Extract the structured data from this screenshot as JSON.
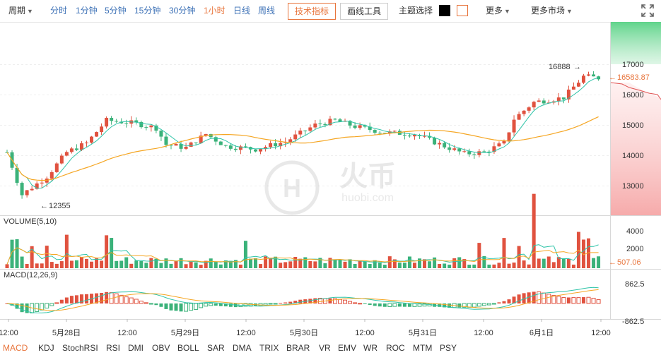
{
  "toolbar": {
    "period_label": "周期",
    "periods": [
      {
        "label": "分时",
        "active": false
      },
      {
        "label": "1分钟",
        "active": false
      },
      {
        "label": "5分钟",
        "active": false
      },
      {
        "label": "15分钟",
        "active": false
      },
      {
        "label": "30分钟",
        "active": false
      },
      {
        "label": "1小时",
        "active": true
      },
      {
        "label": "日线",
        "active": false
      },
      {
        "label": "周线",
        "active": false
      }
    ],
    "tech_indicator_label": "技术指标",
    "draw_tool_label": "画线工具",
    "theme_label": "主题选择",
    "more_label": "更多",
    "more_markets_label": "更多市场"
  },
  "colors": {
    "accent": "#e8743b",
    "up": "#e0523f",
    "down": "#3bb27a",
    "ma_short": "#2ec4a8",
    "ma_long": "#f5a623",
    "link": "#3a6fb5"
  },
  "chart": {
    "high_marker": "16888",
    "low_marker": "12355",
    "current_price": "16583.87",
    "price_ticks": [
      "17000",
      "16000",
      "15000",
      "14000",
      "13000"
    ],
    "volume_label": "VOLUME(5,10)",
    "volume_ticks": [
      "4000",
      "2000"
    ],
    "volume_current": "507.06",
    "macd_label": "MACD(12,26,9)",
    "macd_ticks": [
      "862.5",
      "-862.5"
    ],
    "time_labels": [
      "12:00",
      "5月28日",
      "12:00",
      "5月29日",
      "12:00",
      "5月30日",
      "12:00",
      "5月31日",
      "12:00",
      "6月1日",
      "12:00"
    ],
    "watermark_text": "火币",
    "watermark_sub": "huobi.com"
  },
  "bottom_tabs": [
    {
      "label": "MACD",
      "active": true
    },
    {
      "label": "KDJ",
      "active": false
    },
    {
      "label": "StochRSI",
      "active": false
    },
    {
      "label": "RSI",
      "active": false
    },
    {
      "label": "DMI",
      "active": false
    },
    {
      "label": "OBV",
      "active": false
    },
    {
      "label": "BOLL",
      "active": false
    },
    {
      "label": "SAR",
      "active": false
    },
    {
      "label": "DMA",
      "active": false
    },
    {
      "label": "TRIX",
      "active": false
    },
    {
      "label": "BRAR",
      "active": false
    },
    {
      "label": "VR",
      "active": false
    },
    {
      "label": "EMV",
      "active": false
    },
    {
      "label": "WR",
      "active": false
    },
    {
      "label": "ROC",
      "active": false
    },
    {
      "label": "MTM",
      "active": false
    },
    {
      "label": "PSY",
      "active": false
    }
  ]
}
